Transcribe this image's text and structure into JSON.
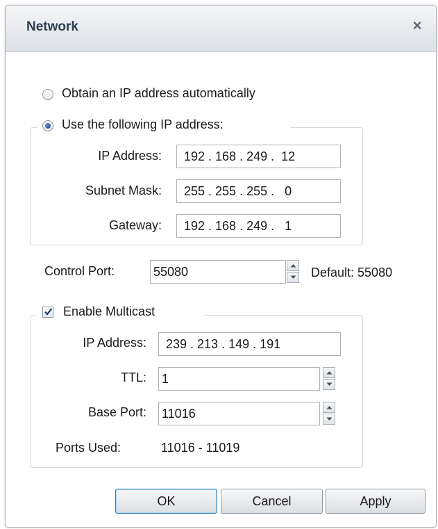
{
  "window": {
    "title": "Network",
    "close_label": "×"
  },
  "ip_mode": {
    "auto_label": "Obtain an IP address automatically",
    "manual_label": "Use the following IP address:",
    "selected": "manual"
  },
  "ip_settings": {
    "ip_address_label": "IP Address:",
    "ip_address_value": "192 . 168 . 249 .  12",
    "subnet_mask_label": "Subnet Mask:",
    "subnet_mask_value": "255 . 255 . 255 .   0",
    "gateway_label": "Gateway:",
    "gateway_value": "192 . 168 . 249 .   1"
  },
  "control_port": {
    "label": "Control Port:",
    "value": "55080",
    "default_text": "Default: 55080"
  },
  "multicast": {
    "enable_label": "Enable Multicast",
    "enabled": true,
    "ip_address_label": "IP Address:",
    "ip_address_value": "239 . 213 . 149 . 191",
    "ttl_label": "TTL:",
    "ttl_value": "1",
    "base_port_label": "Base Port:",
    "base_port_value": "11016",
    "ports_used_label": "Ports Used:",
    "ports_used_value": "11016 - 11019"
  },
  "buttons": {
    "ok": "OK",
    "cancel": "Cancel",
    "apply": "Apply"
  },
  "colors": {
    "title_text": "#2d3d52",
    "default_button_border": "#3c7fb1",
    "radio_dot": "#16407e"
  },
  "icons": {
    "close": "close-icon",
    "spin_up": "chevron-up-icon",
    "spin_down": "chevron-down-icon",
    "check": "checkmark-icon"
  }
}
